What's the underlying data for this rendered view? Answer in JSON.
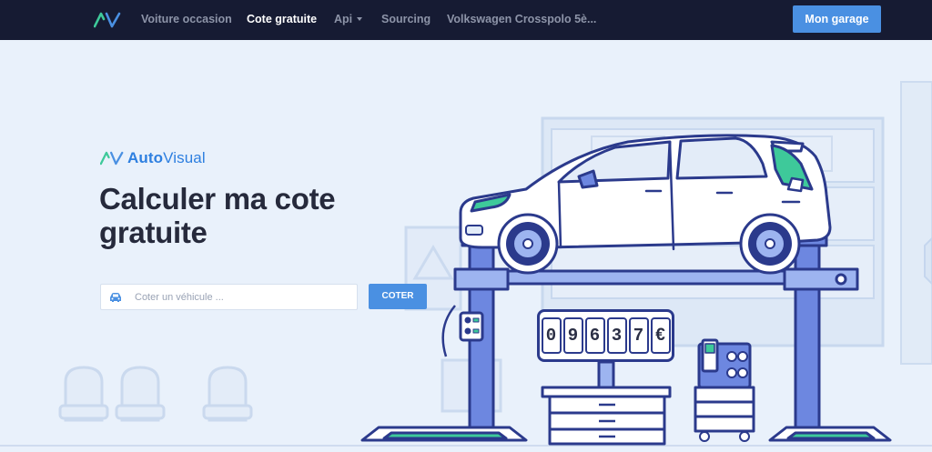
{
  "nav": {
    "logo_icon": "autovisual-logo-icon",
    "items": [
      {
        "label": "Voiture occasion",
        "active": false
      },
      {
        "label": "Cote gratuite",
        "active": true
      },
      {
        "label": "Api",
        "active": false,
        "has_dropdown": true
      },
      {
        "label": "Sourcing",
        "active": false
      },
      {
        "label": "Volkswagen Crosspolo 5è...",
        "active": false
      }
    ],
    "garage_button": "Mon garage"
  },
  "hero": {
    "brand": {
      "part1": "Auto",
      "part2": "Visual"
    },
    "title_line1": "Calculer ma cote",
    "title_line2": "gratuite",
    "search": {
      "placeholder": "Coter un véhicule ...",
      "value": "",
      "icon": "car-icon"
    },
    "submit_label": "COTER"
  },
  "counter": {
    "digits": [
      "0",
      "9",
      "6",
      "3",
      "7",
      "€"
    ]
  },
  "colors": {
    "navbar_bg": "#161b33",
    "accent": "#4a90e2",
    "hero_bg": "#e9f1fb",
    "title_text": "#262a3c",
    "brand_green": "#3ec99a",
    "brand_blue": "#2d7fe0",
    "illustration_blue": "#2b3a8c"
  }
}
